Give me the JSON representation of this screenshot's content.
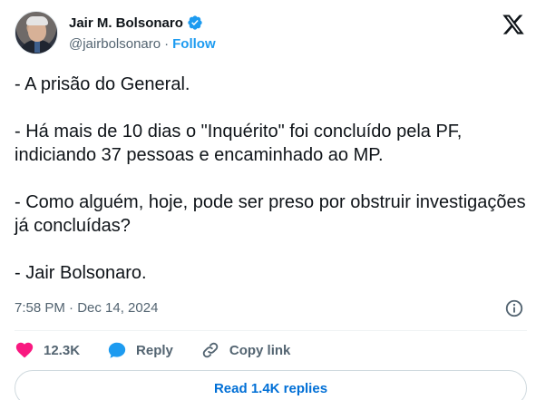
{
  "author": {
    "name": "Jair M. Bolsonaro",
    "handle": "@jairbolsonaro",
    "separator": "·",
    "follow_label": "Follow"
  },
  "tweet": {
    "lines": [
      "- A prisão do General.",
      "- Há mais de 10 dias o \"Inquérito\" foi concluído pela PF, indiciando 37 pessoas e encaminhado ao MP.",
      "- Como alguém, hoje, pode ser preso por obstruir investigações já concluídas?",
      "- Jair Bolsonaro."
    ],
    "timestamp": "7:58 PM · Dec 14, 2024"
  },
  "actions": {
    "likes": "12.3K",
    "reply_label": "Reply",
    "copy_label": "Copy link"
  },
  "replies_button": "Read 1.4K replies",
  "colors": {
    "like": "#f91880",
    "reply": "#1d9bf0",
    "link": "#006fd6",
    "verified": "#1d9bf0"
  },
  "icons": [
    "verified-badge-icon",
    "x-logo-icon",
    "info-icon",
    "heart-icon",
    "reply-bubble-icon",
    "link-icon"
  ]
}
